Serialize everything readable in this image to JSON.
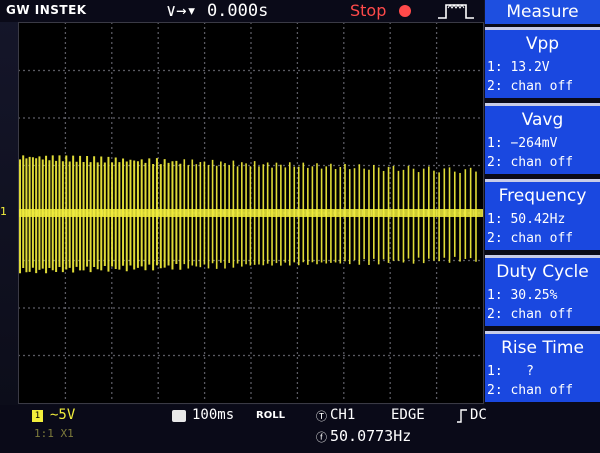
{
  "header": {
    "logo": "GW INSTEK",
    "trigger_info": "∨→▾ 0.000s",
    "run_state": "Stop"
  },
  "panel": {
    "title": "Measure",
    "measurements": [
      {
        "name": "Vpp",
        "ch1": "1: 13.2V",
        "ch2": "2: chan off"
      },
      {
        "name": "Vavg",
        "ch1": "1: −264mV",
        "ch2": "2: chan off"
      },
      {
        "name": "Frequency",
        "ch1": "1: 50.42Hz",
        "ch2": "2: chan off"
      },
      {
        "name": "Duty Cycle",
        "ch1": "1: 30.25%",
        "ch2": "2: chan off"
      },
      {
        "name": "Rise Time",
        "ch1": "1:   ?",
        "ch2": "2: chan off"
      }
    ]
  },
  "channel1": {
    "marker": "1",
    "scale": "∼5V",
    "coupling": "1:1 X1"
  },
  "timebase": {
    "scale": "100ms",
    "mode": "ROLL"
  },
  "trigger": {
    "source": "CH1",
    "type": "EDGE",
    "coupling": "DC",
    "frequency": "50.0773Hz"
  },
  "colors": {
    "ch1_trace": "#f2ee3c",
    "panel_blue": "#1a48e0",
    "stop_red": "#ff4a4a",
    "grid_bg": "#000000"
  }
}
